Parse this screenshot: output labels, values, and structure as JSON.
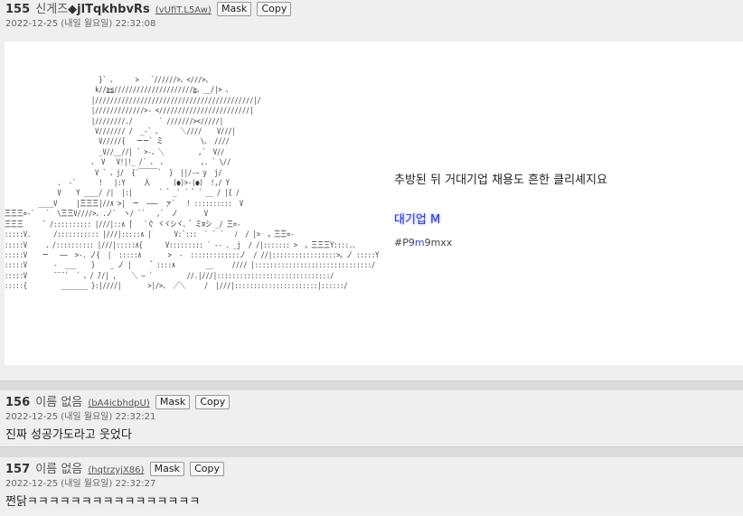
{
  "posts": [
    {
      "number": "155",
      "name_prefix": "신게즈",
      "name_trip": "◆jlTqkhbvRs",
      "uid": "(vUfiT.L5Aw)",
      "mask_label": "Mask",
      "copy_label": "Copy",
      "date": "2022-12-25 (내일 월요일) 22:32:08",
      "ascii_art": "                         }` 、     >   ´//////>、<///>、\n                        k//≧≦/////////////////////≧、__/|> 、\n                       |//////////////////////////////////////////|/\n                       |/////////////>- <////////////////////////|\n                       |////////./       ` ///////></////|\n                        V/////// /  _-` 、     ＼////    V///|\n                         V/////{   ーー` ミ          \\、 ////\n                         _V//__//| ´ >-、＼         ,´  V//\n                       、 V   V!|!_ /` 、 、         ,. ` \\//\n                        V ` 、j/  {´￣￣￣`  }  ||/-― y  j/\n              .  -`      !   |:Y     人      (●)>-(●)  !,/ Y\n              V    Y ____/ /|  |:|       ` ゛_` ´ ゛´ __ / |{ /\n         ____V     |三三三|//∧ >|  ー  ―――  ァ`   ! ::::::::::  V\n三三三=-`   `  \\三三V////>、.ノ`  ヽ/ ``   ,`  ノ       V\n三三三     ̄  /:::::::::: |///|::∧ ̄|   `ぐ ヾヾシヾ、゛ミ≡シ _/ 三=-\n:::::V.      /::::::::::: |///|:::::∧ |      V:`:::  ` ´ ´   ﾉ  / |>  。三三=-\n:::::V     、/:::::::::: |///|:::::∧{      V::::::::: ´ -- . _j  / /|::::::: >  。三三三Y::::.、\n:::::V    ー   ――  >-. ノ{  |  :::::∧       >  -  :::::::::::::ノ  / //|:::::::::::::::::>。ノ :::::Y\n:::::V       -  ___    }    _ ノ |     ゛::::∧        __     //// |:::::::::::::::::::::::::::::::/\n:::::V       ¨¨¨`  ´ 、/ ̄//| ,    ＼ ― `         //.|///|::::::::::::::::::::::::::::::/\n:::::{         _______ }:|////|       >|/>、 ／＼     /  |///|::::::::::::::::::::::|::::::/",
      "side_line1": "추방된 뒤 거대기업 채용도 흔한 클리셰지요",
      "side_line2": "대기업 M",
      "side_line3_pre": "#P9",
      "side_line3_mid": "m",
      "side_line3_post": "9mxx"
    },
    {
      "number": "156",
      "name": "이름 없음",
      "uid": "(bA4icbhdpU)",
      "mask_label": "Mask",
      "copy_label": "Copy",
      "date": "2022-12-25 (내일 월요일) 22:32:21",
      "text": "진짜 성공가도라고 웃었다"
    },
    {
      "number": "157",
      "name": "이름 없음",
      "uid": "(hqtrzyjX86)",
      "mask_label": "Mask",
      "copy_label": "Copy",
      "date": "2022-12-25 (내일 월요일) 22:32:27",
      "text": "쩐닭ㅋㅋㅋㅋㅋㅋㅋㅋㅋㅋㅋㅋㅋㅋㅋㅋ"
    }
  ]
}
